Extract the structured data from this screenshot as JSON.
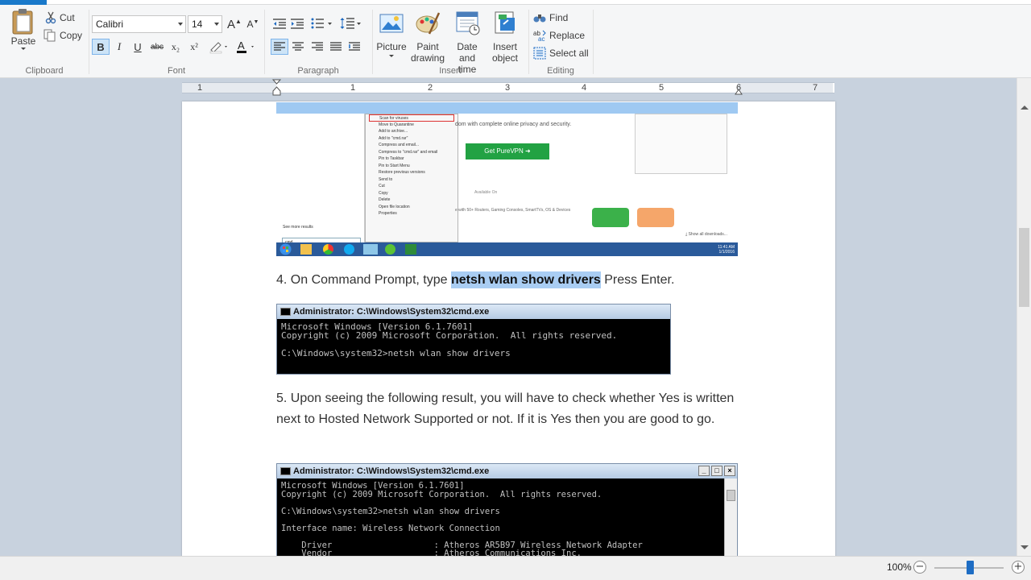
{
  "ribbon": {
    "clipboard": {
      "paste": "Paste",
      "cut": "Cut",
      "copy": "Copy",
      "group": "Clipboard"
    },
    "font": {
      "family": "Calibri",
      "size": "14",
      "group": "Font",
      "bold": "B",
      "italic": "I",
      "underline": "U",
      "strike": "abc",
      "subscript": "x₂",
      "superscript": "x²"
    },
    "paragraph": {
      "group": "Paragraph"
    },
    "insert": {
      "picture": "Picture",
      "paint1": "Paint",
      "paint2": "drawing",
      "date1": "Date and",
      "date2": "time",
      "insert1": "Insert",
      "insert2": "object",
      "group": "Insert"
    },
    "editing": {
      "find": "Find",
      "replace": "Replace",
      "select_all": "Select all",
      "group": "Editing"
    }
  },
  "ruler": {
    "numbers": [
      "1",
      "1",
      "2",
      "3",
      "4",
      "5",
      "6",
      "7"
    ]
  },
  "document": {
    "shot1": {
      "context_menu": [
        "Scan for viruses",
        "Move to Quarantine",
        "Add to archive...",
        "Add to \"cmd.rar\"",
        "Compress and email...",
        "Compress to \"cmd.rar\" and email",
        "Pin to Taskbar",
        "Pin to Start Menu",
        "Restore previous versions",
        "Send to",
        "Cut",
        "Copy",
        "Delete",
        "Open file location",
        "Properties"
      ],
      "privacy_text": "dom with complete online privacy and security.",
      "vpn_button": "Get PureVPN ➜",
      "available_on": "Available On",
      "routers_text": "e with 50+ Routers, Gaming Consoles, SmartTVs, OS & Devices",
      "show_all": "⤓ Show all downloads...",
      "see_more": "See more results",
      "search_value": "cmd",
      "clock_time": "11:41 AM",
      "clock_date": "1/1/2016"
    },
    "step4": {
      "prefix": "4. On Command Prompt, type ",
      "command": "netsh wlan show drivers",
      "suffix": " Press Enter."
    },
    "cmd1": {
      "title": "Administrator: C:\\Windows\\System32\\cmd.exe",
      "body": "Microsoft Windows [Version 6.1.7601]\nCopyright (c) 2009 Microsoft Corporation.  All rights reserved.\n\nC:\\Windows\\system32>netsh wlan show drivers"
    },
    "step5": "5. Upon seeing the following result, you will have to check whether Yes is written next to Hosted Network Supported or not. If it is Yes then you are good to go.",
    "cmd2": {
      "title": "Administrator: C:\\Windows\\System32\\cmd.exe",
      "body": "Microsoft Windows [Version 6.1.7601]\nCopyright (c) 2009 Microsoft Corporation.  All rights reserved.\n\nC:\\Windows\\system32>netsh wlan show drivers\n\nInterface name: Wireless Network Connection\n\n    Driver                    : Atheros AR5B97 Wireless Network Adapter\n    Vendor                    : Atheros Communications Inc."
    }
  },
  "status": {
    "zoom": "100%",
    "zoom_out": "−",
    "zoom_in": "+",
    "zoom_level": 1.0
  },
  "colors": {
    "accent": "#1979ca",
    "highlight": "#a9cdf3",
    "vpn_green": "#22a243"
  }
}
